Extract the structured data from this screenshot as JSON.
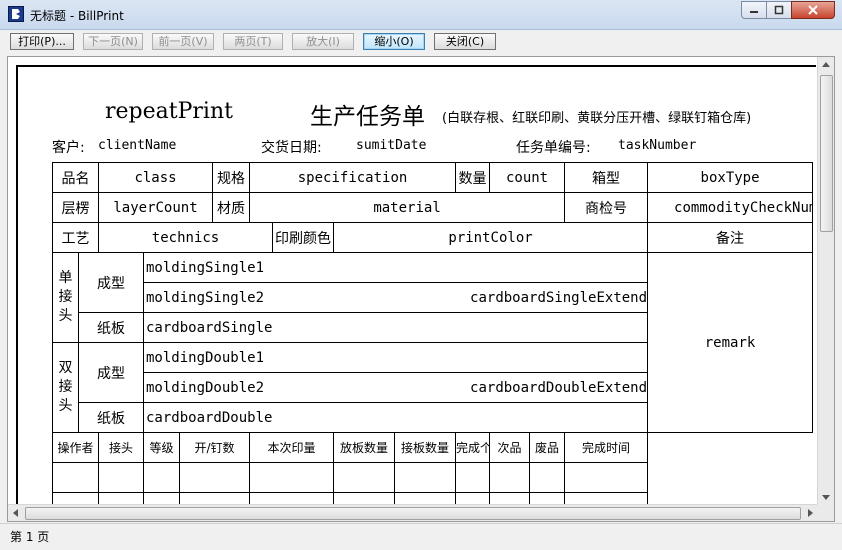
{
  "window": {
    "title": "无标题 - BillPrint",
    "min_label": "",
    "max_label": "",
    "close_label": ""
  },
  "toolbar": {
    "print": "打印(P)...",
    "next_page": "下一页(N)",
    "prev_page": "前一页(V)",
    "two_pages": "两页(T)",
    "zoom_in": "放大(I)",
    "zoom_out": "缩小(O)",
    "close": "关闭(C)"
  },
  "document": {
    "title_left": "repeatPrint",
    "title_main": "生产任务单",
    "title_note": "(白联存根、红联印刷、黄联分压开槽、绿联钉箱仓库)",
    "client_label": "客户:",
    "client_value": "clientName",
    "delivery_label": "交货日期:",
    "delivery_value": "sumitDate",
    "task_label": "任务单编号:",
    "task_value": "taskNumber",
    "row1": {
      "product_label": "品名",
      "product_value": "class",
      "spec_label": "规格",
      "spec_value": "specification",
      "qty_label": "数量",
      "qty_value": "count",
      "box_label": "箱型",
      "box_value": "boxType"
    },
    "row2": {
      "layer_label": "层楞",
      "layer_value": "layerCount",
      "material_label": "材质",
      "material_value": "material",
      "check_label": "商检号",
      "check_value": "commodityCheckNum"
    },
    "row3": {
      "tech_label": "工艺",
      "tech_value": "technics",
      "color_label": "印刷颜色",
      "color_value": "printColor",
      "remark_label": "备注",
      "remark_value": "remark"
    },
    "single": {
      "group_label": "单接头",
      "forming_label": "成型",
      "board_label": "纸板",
      "molding1": "moldingSingle1",
      "molding2": "moldingSingle2",
      "extend": "cardboardSingleExtend",
      "cardboard": "cardboardSingle"
    },
    "double": {
      "group_label": "双接头",
      "forming_label": "成型",
      "board_label": "纸板",
      "molding1": "moldingDouble1",
      "molding2": "moldingDouble2",
      "extend": "cardboardDoubleExtend",
      "cardboard": "cardboardDouble"
    },
    "op_headers": [
      "操作者",
      "接头",
      "等级",
      "开/钉数",
      "本次印量",
      "放板数量",
      "接板数量",
      "完成个数",
      "次品",
      "废品",
      "完成时间"
    ]
  },
  "status": {
    "page_text": "第 1 页"
  }
}
